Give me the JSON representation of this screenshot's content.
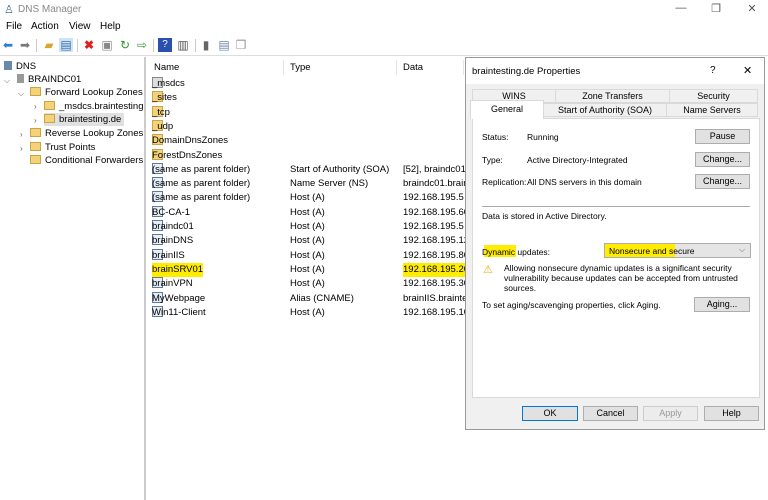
{
  "window": {
    "title": "DNS Manager",
    "minimize": "—",
    "maximize": "❐",
    "close": "✕"
  },
  "menu": [
    "File",
    "Action",
    "View",
    "Help"
  ],
  "toolbar": {
    "icons": [
      "back-icon",
      "forward-icon",
      "up-folder-icon",
      "show-hide-tree-icon",
      "delete-icon",
      "properties-icon",
      "refresh-icon",
      "export-icon",
      "help-icon",
      "action-pane-icon",
      "server-icon",
      "record-icon",
      "copy-record-icon"
    ]
  },
  "tree": {
    "root": "DNS",
    "server": "BRAINDC01",
    "flz": "Forward Lookup Zones",
    "zone1": "_msdcs.braintesting.de",
    "zone2": "braintesting.de",
    "rlz": "Reverse Lookup Zones",
    "tp": "Trust Points",
    "cf": "Conditional Forwarders"
  },
  "list": {
    "columns": [
      "Name",
      "Type",
      "Data"
    ],
    "rows": [
      {
        "name": "_msdcs",
        "type": "",
        "data": "",
        "icon": "delegated-folder"
      },
      {
        "name": "_sites",
        "type": "",
        "data": "",
        "icon": "folder"
      },
      {
        "name": "_tcp",
        "type": "",
        "data": "",
        "icon": "folder"
      },
      {
        "name": "_udp",
        "type": "",
        "data": "",
        "icon": "folder"
      },
      {
        "name": "DomainDnsZones",
        "type": "",
        "data": "",
        "icon": "folder"
      },
      {
        "name": "ForestDnsZones",
        "type": "",
        "data": "",
        "icon": "folder"
      },
      {
        "name": "(same as parent folder)",
        "type": "Start of Authority (SOA)",
        "data": "[52], braindc01.",
        "icon": "record"
      },
      {
        "name": "(same as parent folder)",
        "type": "Name Server (NS)",
        "data": "braindc01.brain",
        "icon": "record"
      },
      {
        "name": "(same as parent folder)",
        "type": "Host (A)",
        "data": "192.168.195.5",
        "icon": "record"
      },
      {
        "name": "BC-CA-1",
        "type": "Host (A)",
        "data": "192.168.195.60",
        "icon": "record"
      },
      {
        "name": "braindc01",
        "type": "Host (A)",
        "data": "192.168.195.5",
        "icon": "record"
      },
      {
        "name": "brainDNS",
        "type": "Host (A)",
        "data": "192.168.195.120",
        "icon": "record"
      },
      {
        "name": "brainIIS",
        "type": "Host (A)",
        "data": "192.168.195.80",
        "icon": "record"
      },
      {
        "name": "brainSRV01",
        "type": "Host (A)",
        "data": "192.168.195.200",
        "icon": "record",
        "highlight": true
      },
      {
        "name": "brainVPN",
        "type": "Host (A)",
        "data": "192.168.195.30",
        "icon": "record"
      },
      {
        "name": "MyWebpage",
        "type": "Alias (CNAME)",
        "data": "brainIIS.braintes",
        "icon": "record"
      },
      {
        "name": "Win11-Client",
        "type": "Host (A)",
        "data": "192.168.195.100",
        "icon": "record"
      }
    ]
  },
  "dialog": {
    "title": "braintesting.de Properties",
    "help": "?",
    "close": "✕",
    "tabs_top": [
      "WINS",
      "Zone Transfers",
      "Security"
    ],
    "tabs_bottom": [
      "General",
      "Start of Authority (SOA)",
      "Name Servers"
    ],
    "active_tab": "General",
    "status_label": "Status:",
    "status_value": "Running",
    "pause": "Pause",
    "type_label": "Type:",
    "type_value": "Active Directory-Integrated",
    "change1": "Change...",
    "repl_label": "Replication:",
    "repl_value": "All DNS servers in this domain",
    "change2": "Change...",
    "stored": "Data is stored in Active Directory.",
    "dyn_label": "Dynamic updates:",
    "dyn_value": "Nonsecure and secure",
    "warning": "Allowing nonsecure dynamic updates is a significant security vulnerability because updates can be accepted from untrusted sources.",
    "aging_text": "To set aging/scavenging properties, click Aging.",
    "aging": "Aging...",
    "ok": "OK",
    "cancel": "Cancel",
    "apply": "Apply",
    "helpbtn": "Help",
    "highlight_color": "#ffec00"
  }
}
